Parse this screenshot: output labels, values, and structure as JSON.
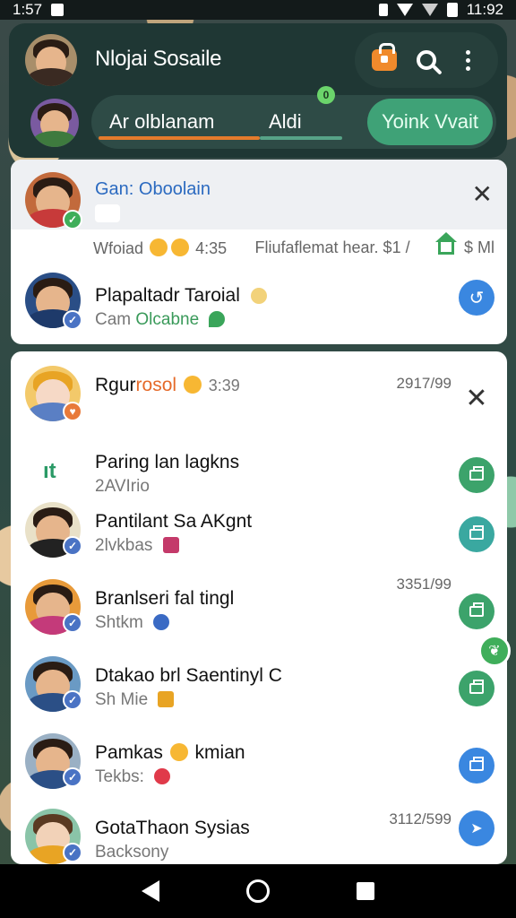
{
  "status_bar": {
    "time_left": "1:57",
    "time_right": "11:92"
  },
  "header": {
    "title": "Nlojai Sosaile",
    "tabs": [
      {
        "label": "Ar olblanam"
      },
      {
        "label": "Aldi",
        "badge": "0"
      },
      {
        "label": "Yoink Vvait"
      }
    ],
    "icons": [
      "bag-icon",
      "search-icon",
      "more-vert-icon"
    ]
  },
  "pinned": {
    "top": {
      "name": "Gan: Oboolain",
      "meta_left_prefix": "Wfoiad",
      "meta_left_time": "4:35",
      "meta_right": "Fliufaflemat hear.  $1 /",
      "meta_right_amount": "$ Ml"
    },
    "second": {
      "name": "Plapaltadr Taroial",
      "sub_prefix": "Cam",
      "sub_accent": "Olcabne"
    }
  },
  "chats": [
    {
      "name_a": "Rgur",
      "name_b": "rosol",
      "inline_time": "3:39",
      "time": "2917/99",
      "sub": "",
      "action": "close"
    },
    {
      "name": "Paring lan lagkns",
      "sub": "2AVIrio",
      "time": "",
      "action": "calendar"
    },
    {
      "name": "Pantilant Sa AKgnt",
      "sub": "2lvkbas",
      "time": "",
      "action": "calendar"
    },
    {
      "name": "Branlseri fal tingl",
      "sub": "Shtkm",
      "time": "3351/99",
      "action": "calendar"
    },
    {
      "name": "Dtakao brl Saentinyl C",
      "sub": "Sh Mie",
      "time": "",
      "action": "calendar"
    },
    {
      "name": "Pamkas",
      "name_b": "kmian",
      "sub": "Tekbs:",
      "time": "",
      "action": "calendar"
    },
    {
      "name": "GotaThaon Sysias",
      "sub": "Backsony",
      "time": "3112/599",
      "action": "send"
    }
  ],
  "colors": {
    "header_bg": "#1f3734",
    "accent_green": "#3fa277",
    "accent_orange": "#e47b2c",
    "link_blue": "#2b6ac0"
  }
}
